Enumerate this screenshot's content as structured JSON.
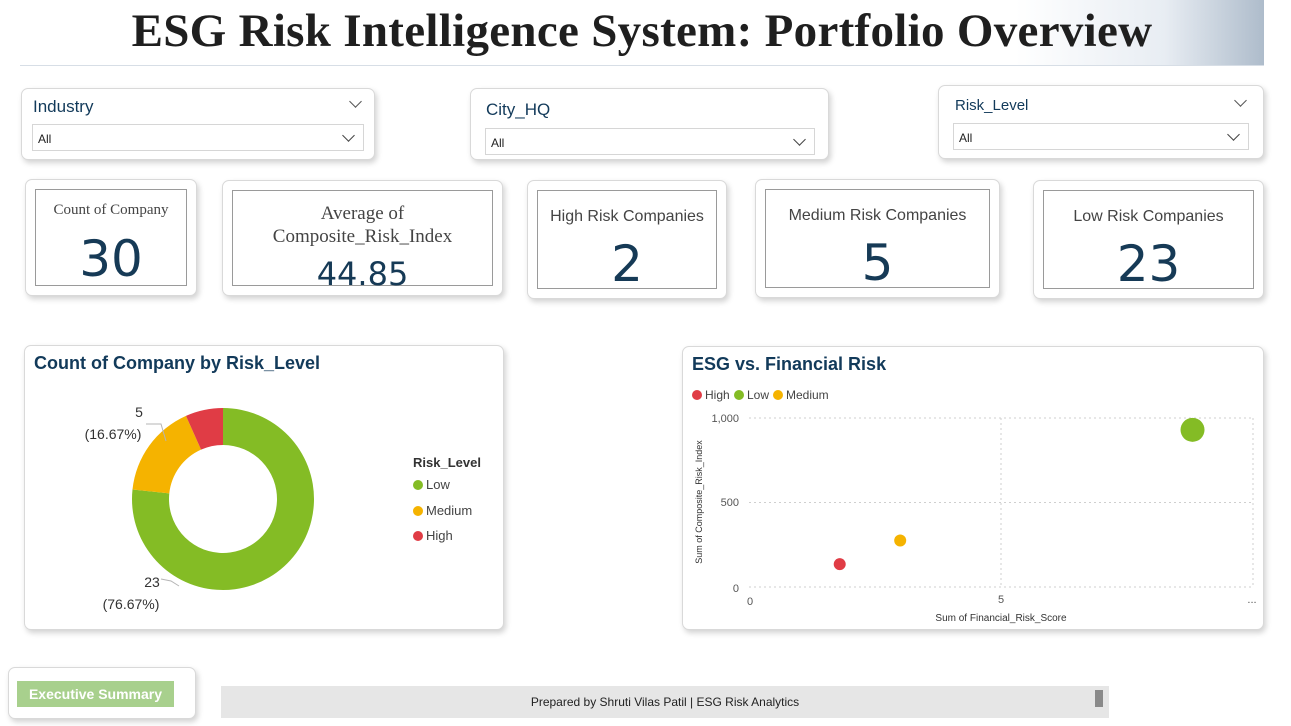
{
  "header": {
    "title": "ESG Risk Intelligence System: Portfolio Overview"
  },
  "filters": [
    {
      "label": "Industry",
      "value": "All"
    },
    {
      "label": "City_HQ",
      "value": "All"
    },
    {
      "label": "Risk_Level",
      "value": "All"
    }
  ],
  "kpis": {
    "count_company": {
      "label": "Count of Company",
      "value": "30"
    },
    "avg_cri": {
      "label_line1": "Average of",
      "label_line2": "Composite_Risk_Index",
      "value": "44.85"
    },
    "high_risk": {
      "label": "High Risk Companies",
      "value": "2"
    },
    "medium_risk": {
      "label": "Medium Risk Companies",
      "value": "5"
    },
    "low_risk": {
      "label": "Low Risk Companies",
      "value": "23"
    }
  },
  "donut": {
    "title": "Count of Company by Risk_Level",
    "legend_title": "Risk_Level",
    "label_medium_count": "5",
    "label_medium_pct": "(16.67%)",
    "label_low_count": "23",
    "label_low_pct": "(76.67%)"
  },
  "scatter": {
    "title": "ESG vs. Financial Risk",
    "legend": [
      "High",
      "Low",
      "Medium"
    ],
    "xlabel": "Sum of Financial_Risk_Score",
    "ylabel": "Sum of Composite_Risk_Index",
    "yticks": [
      "1,000",
      "500",
      "0"
    ],
    "xticks": [
      "0",
      "5",
      "..."
    ]
  },
  "chart_data": [
    {
      "type": "pie",
      "title": "Count of Company by Risk_Level",
      "categories": [
        "Low",
        "Medium",
        "High"
      ],
      "values": [
        23,
        5,
        2
      ],
      "colors": [
        "#84bc25",
        "#f5b300",
        "#e03c45"
      ],
      "legend_placement": "right"
    },
    {
      "type": "scatter",
      "title": "ESG vs. Financial Risk",
      "xlabel": "Sum of Financial_Risk_Score",
      "ylabel": "Sum of Composite_Risk_Index",
      "xlim": [
        0,
        10
      ],
      "ylim": [
        0,
        1000
      ],
      "series": [
        {
          "name": "High",
          "color": "#e03c45",
          "points": [
            [
              1.8,
              135
            ]
          ]
        },
        {
          "name": "Low",
          "color": "#84bc25",
          "points": [
            [
              8.8,
              930
            ]
          ]
        },
        {
          "name": "Medium",
          "color": "#f5b300",
          "points": [
            [
              3.0,
              275
            ]
          ]
        }
      ],
      "legend_placement": "top-left",
      "grid": true
    }
  ],
  "footer": {
    "button_label": "Executive Summary",
    "credit": "Prepared by Shruti Vilas Patil | ESG Risk Analytics"
  },
  "colors": {
    "title_blue": "#123a5a",
    "kpi_blue": "#163a56",
    "button_green": "#a8d08d"
  }
}
